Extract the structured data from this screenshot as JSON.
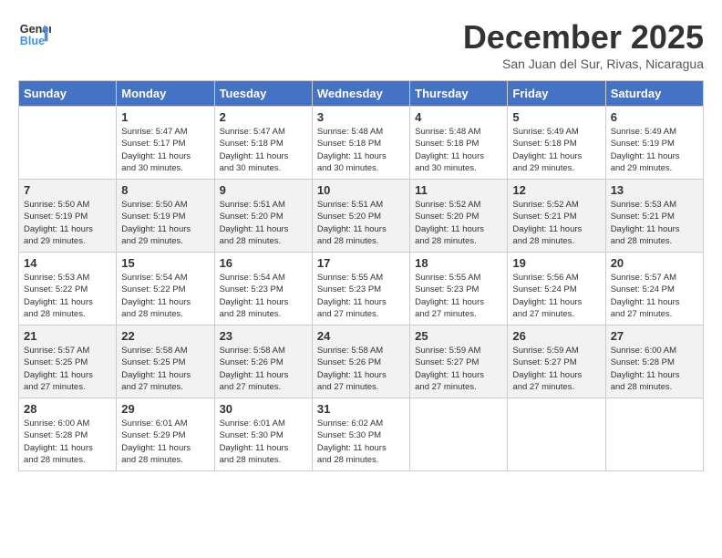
{
  "header": {
    "logo_line1": "General",
    "logo_line2": "Blue",
    "month": "December 2025",
    "location": "San Juan del Sur, Rivas, Nicaragua"
  },
  "days_of_week": [
    "Sunday",
    "Monday",
    "Tuesday",
    "Wednesday",
    "Thursday",
    "Friday",
    "Saturday"
  ],
  "weeks": [
    [
      {
        "day": "",
        "info": ""
      },
      {
        "day": "1",
        "info": "Sunrise: 5:47 AM\nSunset: 5:17 PM\nDaylight: 11 hours\nand 30 minutes."
      },
      {
        "day": "2",
        "info": "Sunrise: 5:47 AM\nSunset: 5:18 PM\nDaylight: 11 hours\nand 30 minutes."
      },
      {
        "day": "3",
        "info": "Sunrise: 5:48 AM\nSunset: 5:18 PM\nDaylight: 11 hours\nand 30 minutes."
      },
      {
        "day": "4",
        "info": "Sunrise: 5:48 AM\nSunset: 5:18 PM\nDaylight: 11 hours\nand 30 minutes."
      },
      {
        "day": "5",
        "info": "Sunrise: 5:49 AM\nSunset: 5:18 PM\nDaylight: 11 hours\nand 29 minutes."
      },
      {
        "day": "6",
        "info": "Sunrise: 5:49 AM\nSunset: 5:19 PM\nDaylight: 11 hours\nand 29 minutes."
      }
    ],
    [
      {
        "day": "7",
        "info": "Sunrise: 5:50 AM\nSunset: 5:19 PM\nDaylight: 11 hours\nand 29 minutes."
      },
      {
        "day": "8",
        "info": "Sunrise: 5:50 AM\nSunset: 5:19 PM\nDaylight: 11 hours\nand 29 minutes."
      },
      {
        "day": "9",
        "info": "Sunrise: 5:51 AM\nSunset: 5:20 PM\nDaylight: 11 hours\nand 28 minutes."
      },
      {
        "day": "10",
        "info": "Sunrise: 5:51 AM\nSunset: 5:20 PM\nDaylight: 11 hours\nand 28 minutes."
      },
      {
        "day": "11",
        "info": "Sunrise: 5:52 AM\nSunset: 5:20 PM\nDaylight: 11 hours\nand 28 minutes."
      },
      {
        "day": "12",
        "info": "Sunrise: 5:52 AM\nSunset: 5:21 PM\nDaylight: 11 hours\nand 28 minutes."
      },
      {
        "day": "13",
        "info": "Sunrise: 5:53 AM\nSunset: 5:21 PM\nDaylight: 11 hours\nand 28 minutes."
      }
    ],
    [
      {
        "day": "14",
        "info": "Sunrise: 5:53 AM\nSunset: 5:22 PM\nDaylight: 11 hours\nand 28 minutes."
      },
      {
        "day": "15",
        "info": "Sunrise: 5:54 AM\nSunset: 5:22 PM\nDaylight: 11 hours\nand 28 minutes."
      },
      {
        "day": "16",
        "info": "Sunrise: 5:54 AM\nSunset: 5:23 PM\nDaylight: 11 hours\nand 28 minutes."
      },
      {
        "day": "17",
        "info": "Sunrise: 5:55 AM\nSunset: 5:23 PM\nDaylight: 11 hours\nand 27 minutes."
      },
      {
        "day": "18",
        "info": "Sunrise: 5:55 AM\nSunset: 5:23 PM\nDaylight: 11 hours\nand 27 minutes."
      },
      {
        "day": "19",
        "info": "Sunrise: 5:56 AM\nSunset: 5:24 PM\nDaylight: 11 hours\nand 27 minutes."
      },
      {
        "day": "20",
        "info": "Sunrise: 5:57 AM\nSunset: 5:24 PM\nDaylight: 11 hours\nand 27 minutes."
      }
    ],
    [
      {
        "day": "21",
        "info": "Sunrise: 5:57 AM\nSunset: 5:25 PM\nDaylight: 11 hours\nand 27 minutes."
      },
      {
        "day": "22",
        "info": "Sunrise: 5:58 AM\nSunset: 5:25 PM\nDaylight: 11 hours\nand 27 minutes."
      },
      {
        "day": "23",
        "info": "Sunrise: 5:58 AM\nSunset: 5:26 PM\nDaylight: 11 hours\nand 27 minutes."
      },
      {
        "day": "24",
        "info": "Sunrise: 5:58 AM\nSunset: 5:26 PM\nDaylight: 11 hours\nand 27 minutes."
      },
      {
        "day": "25",
        "info": "Sunrise: 5:59 AM\nSunset: 5:27 PM\nDaylight: 11 hours\nand 27 minutes."
      },
      {
        "day": "26",
        "info": "Sunrise: 5:59 AM\nSunset: 5:27 PM\nDaylight: 11 hours\nand 27 minutes."
      },
      {
        "day": "27",
        "info": "Sunrise: 6:00 AM\nSunset: 5:28 PM\nDaylight: 11 hours\nand 28 minutes."
      }
    ],
    [
      {
        "day": "28",
        "info": "Sunrise: 6:00 AM\nSunset: 5:28 PM\nDaylight: 11 hours\nand 28 minutes."
      },
      {
        "day": "29",
        "info": "Sunrise: 6:01 AM\nSunset: 5:29 PM\nDaylight: 11 hours\nand 28 minutes."
      },
      {
        "day": "30",
        "info": "Sunrise: 6:01 AM\nSunset: 5:30 PM\nDaylight: 11 hours\nand 28 minutes."
      },
      {
        "day": "31",
        "info": "Sunrise: 6:02 AM\nSunset: 5:30 PM\nDaylight: 11 hours\nand 28 minutes."
      },
      {
        "day": "",
        "info": ""
      },
      {
        "day": "",
        "info": ""
      },
      {
        "day": "",
        "info": ""
      }
    ]
  ]
}
